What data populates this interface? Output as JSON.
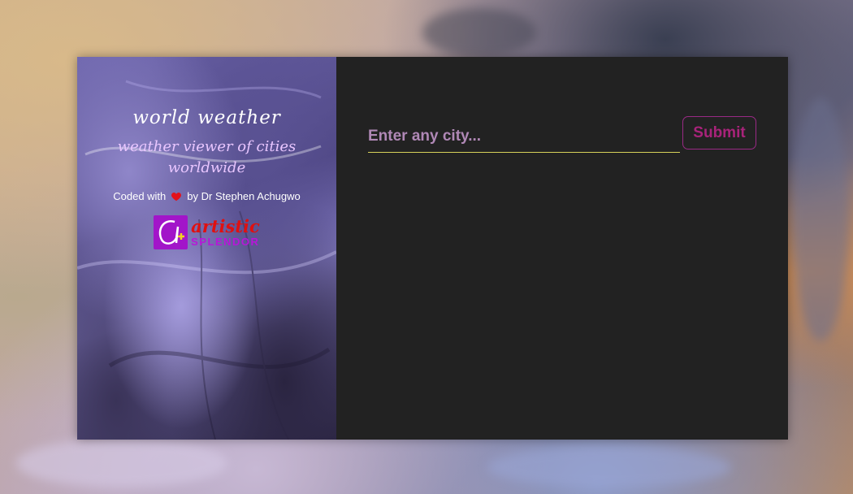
{
  "sidebar": {
    "title": "world weather",
    "subtitle": "weather viewer of cities worldwide",
    "credit_prefix": "Coded with",
    "credit_icon": "heart-icon",
    "credit_suffix": "by Dr Stephen Achugwo",
    "logo": {
      "word_1": "artistic",
      "word_2": "SPLENDOR"
    }
  },
  "search": {
    "placeholder": "Enter any city...",
    "value": "",
    "submit_label": "Submit"
  },
  "colors": {
    "panel_bg": "#222222",
    "input_underline": "#d7d25a",
    "submit_text": "#a8237a",
    "logo_mark": "#a215c9",
    "logo_red": "#e01010"
  }
}
